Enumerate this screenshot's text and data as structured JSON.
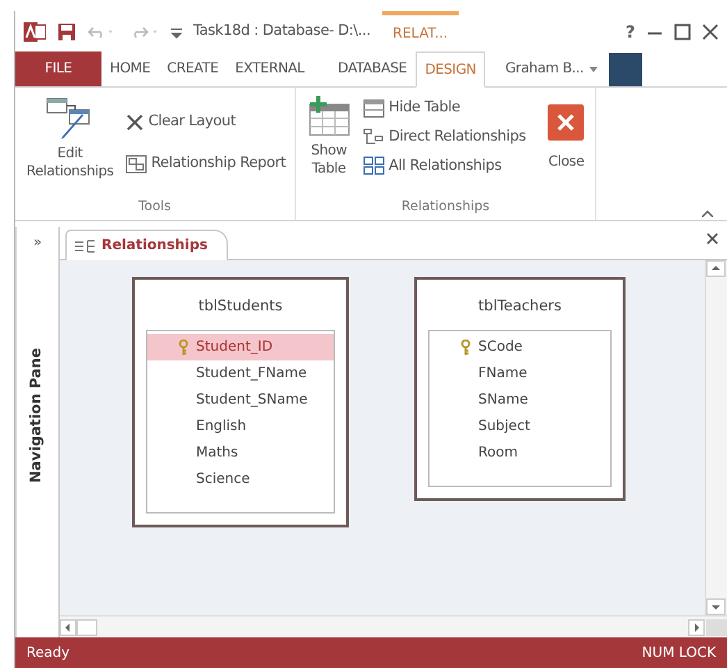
{
  "title_bar": {
    "title": "Task18d : Database- D:\\...",
    "context_tab": "RELAT...",
    "help": "?"
  },
  "ribbon_tabs": [
    {
      "label": "FILE",
      "kind": "file",
      "selected": false
    },
    {
      "label": "HOME",
      "kind": "tab",
      "selected": false
    },
    {
      "label": "CREATE",
      "kind": "tab",
      "selected": false
    },
    {
      "label": "EXTERNAL",
      "kind": "tab",
      "selected": false
    },
    {
      "label": "DATABASE",
      "kind": "tab",
      "selected": false
    },
    {
      "label": "DESIGN",
      "kind": "tab",
      "selected": true
    }
  ],
  "user": {
    "name": "Graham B..."
  },
  "ribbon_groups": [
    {
      "label": "Tools",
      "items": [
        {
          "kind": "large",
          "label": "Edit Relationships"
        },
        {
          "kind": "small",
          "label": "Clear Layout"
        },
        {
          "kind": "small",
          "label": "Relationship Report"
        }
      ]
    },
    {
      "label": "Relationships",
      "items": [
        {
          "kind": "large",
          "label": "Show Table"
        },
        {
          "kind": "small",
          "label": "Hide Table"
        },
        {
          "kind": "small",
          "label": "Direct Relationships"
        },
        {
          "kind": "small",
          "label": "All Relationships"
        },
        {
          "kind": "large",
          "label": "Close"
        }
      ]
    }
  ],
  "navigation_pane": {
    "toggle": "»",
    "label": "Navigation Pane"
  },
  "document_tabs": [
    {
      "label": "Relationships",
      "selected": true
    }
  ],
  "tables": [
    {
      "name": "tblStudents",
      "fields": [
        {
          "name": "Student_ID",
          "primary_key": true,
          "selected": true
        },
        {
          "name": "Student_FName",
          "primary_key": false,
          "selected": false
        },
        {
          "name": "Student_SName",
          "primary_key": false,
          "selected": false
        },
        {
          "name": "English",
          "primary_key": false,
          "selected": false
        },
        {
          "name": "Maths",
          "primary_key": false,
          "selected": false
        },
        {
          "name": "Science",
          "primary_key": false,
          "selected": false
        }
      ]
    },
    {
      "name": "tblTeachers",
      "fields": [
        {
          "name": "SCode",
          "primary_key": true,
          "selected": false
        },
        {
          "name": "FName",
          "primary_key": false,
          "selected": false
        },
        {
          "name": "SName",
          "primary_key": false,
          "selected": false
        },
        {
          "name": "Subject",
          "primary_key": false,
          "selected": false
        },
        {
          "name": "Room",
          "primary_key": false,
          "selected": false
        }
      ]
    }
  ],
  "status_bar": {
    "left": "Ready",
    "right": "NUM LOCK"
  }
}
